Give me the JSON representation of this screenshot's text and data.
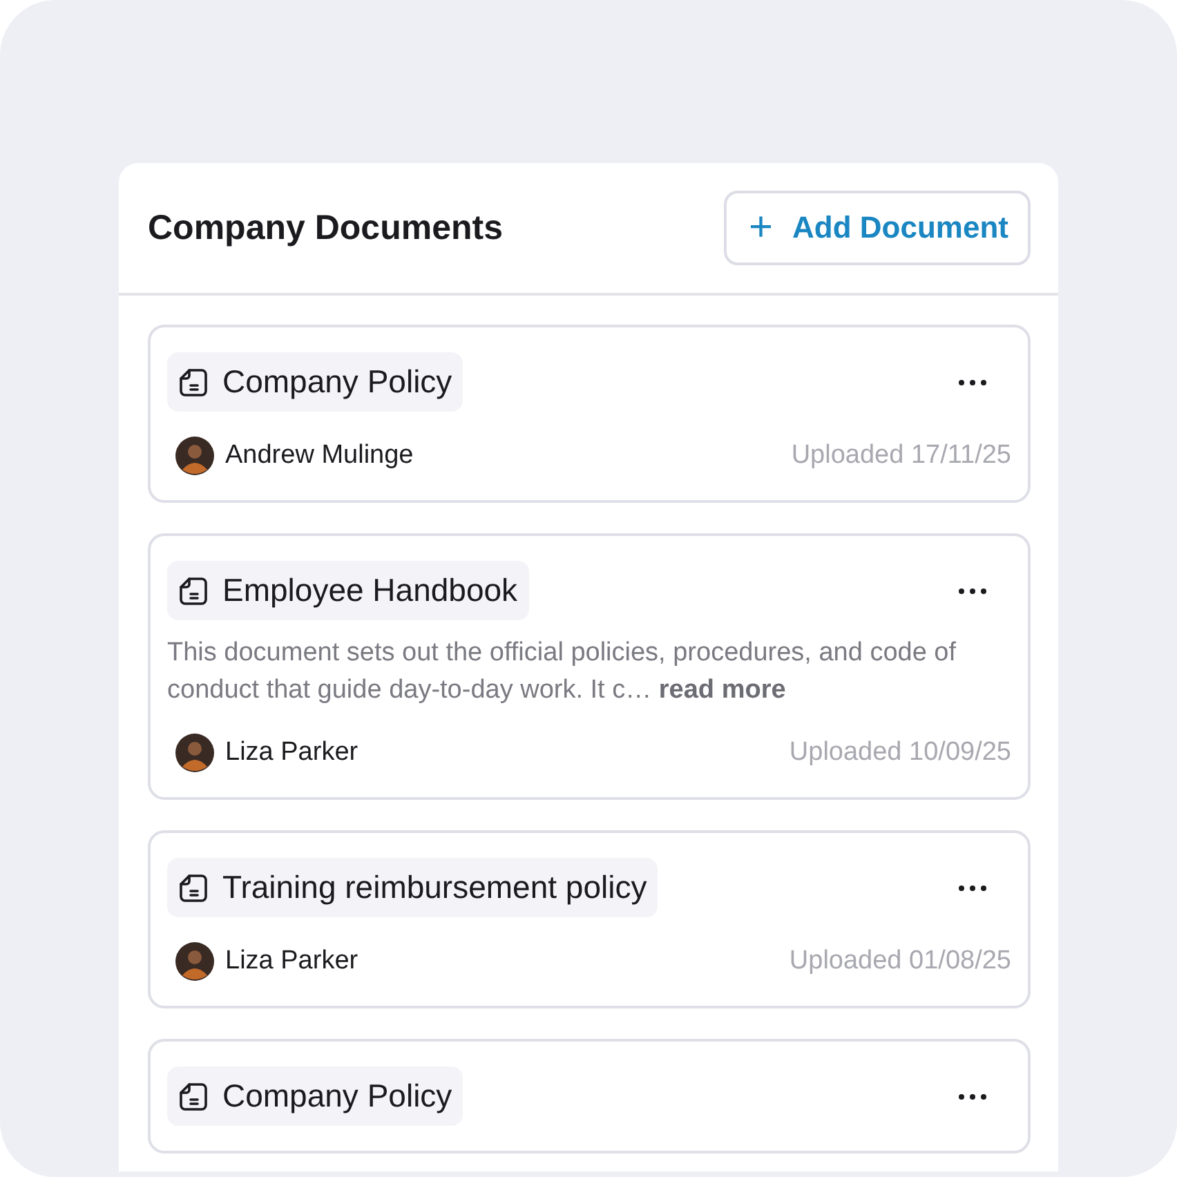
{
  "header": {
    "title": "Company Documents",
    "add_button": {
      "icon": "+",
      "label": "Add Document"
    }
  },
  "documents": [
    {
      "title": "Company Policy",
      "author": "Andrew Mulinge",
      "uploaded": "Uploaded 17/11/25"
    },
    {
      "title": "Employee Handbook",
      "description": "This document sets out the official policies, procedures, and code of conduct that guide day-to-day work. It c… **read more**",
      "author": "Liza Parker",
      "uploaded": "Uploaded 10/09/25"
    },
    {
      "title": "Training reimbursement policy",
      "author": "Liza Parker",
      "uploaded": "Uploaded 01/08/25"
    },
    {
      "title": "Company Policy"
    }
  ]
}
